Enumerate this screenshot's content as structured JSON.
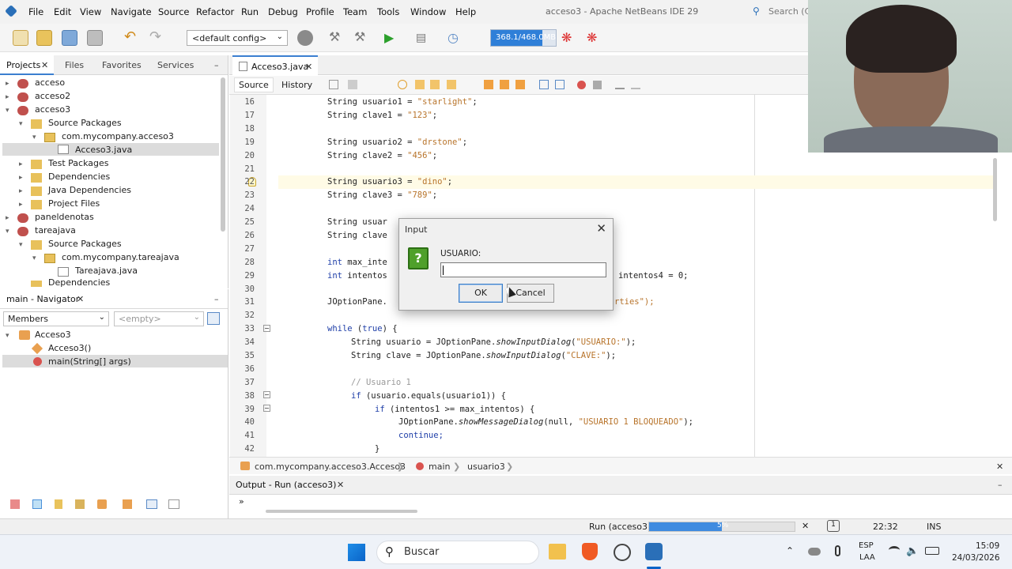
{
  "window": {
    "title": "acceso3 - Apache NetBeans IDE 29",
    "search_placeholder": "Search (Ct"
  },
  "menu": [
    "File",
    "Edit",
    "View",
    "Navigate",
    "Source",
    "Refactor",
    "Run",
    "Debug",
    "Profile",
    "Team",
    "Tools",
    "Window",
    "Help"
  ],
  "toolbar": {
    "config": "<default config>",
    "memory": "368.1/468.0MB",
    "memory_used_fraction": 0.79
  },
  "projects_panel": {
    "tabs": [
      "Projects",
      "Files",
      "Favorites",
      "Services"
    ],
    "tree": [
      "acceso",
      "acceso2",
      "acceso3",
      "Source Packages",
      "com.mycompany.acceso3",
      "Acceso3.java",
      "Test Packages",
      "Dependencies",
      "Java Dependencies",
      "Project Files",
      "paneldenotas",
      "tareajava",
      "Source Packages",
      "com.mycompany.tareajava",
      "Tareajava.java",
      "Dependencies"
    ]
  },
  "navigator": {
    "title": "main - Navigator",
    "members": "Members",
    "empty": "<empty>",
    "tree": [
      "Acceso3",
      "Acceso3()",
      "main(String[] args)"
    ]
  },
  "editor": {
    "tab": "Acceso3.java",
    "views": [
      "Source",
      "History"
    ],
    "line_numbers": [
      "16",
      "17",
      "18",
      "19",
      "20",
      "21",
      "22",
      "23",
      "24",
      "25",
      "26",
      "27",
      "28",
      "29",
      "30",
      "31",
      "32",
      "33",
      "34",
      "35",
      "36",
      "37",
      "38",
      "39",
      "40",
      "41",
      "42"
    ],
    "code": {
      "l16a": "String usuario1 = ",
      "l16b": "\"starlight\"",
      "l16c": ";",
      "l17a": "String clave1 = ",
      "l17b": "\"123\"",
      "l17c": ";",
      "l19a": "String usuario2 = ",
      "l19b": "\"drstone\"",
      "l19c": ";",
      "l20a": "String clave2 = ",
      "l20b": "\"456\"",
      "l20c": ";",
      "l22a": "String usuario3 = ",
      "l22b": "\"dino\"",
      "l22c": ";",
      "l23a": "String clave3 = ",
      "l23b": "\"789\"",
      "l23c": ";",
      "l25": "String usuar",
      "l26": "String clave",
      "l28a": "int",
      "l28b": " max_inte",
      "l29a": "int",
      "l29b": " intentos",
      "l29c": "intentos4 = 0;",
      "l31": "JOptionPane.",
      "l31b": "rties\");",
      "l33a": "while",
      "l33b": " (",
      "l33c": "true",
      "l33d": ") {",
      "l34a": "String usuario = JOptionPane.",
      "l34b": "showInputDialog",
      "l34c": "(",
      "l34d": "\"USUARIO:\"",
      "l34e": ");",
      "l35a": "String clave = JOptionPane.",
      "l35b": "showInputDialog",
      "l35c": "(",
      "l35d": "\"CLAVE:\"",
      "l35e": ");",
      "l37": "// Usuario 1",
      "l38a": "if",
      "l38b": " (usuario.equals(usuario1)) {",
      "l39a": "if",
      "l39b": " (intentos1 >= max_intentos) {",
      "l40a": "JOptionPane.",
      "l40b": "showMessageDialog",
      "l40c": "(null, ",
      "l40d": "\"USUARIO 1 BLOQUEADO\"",
      "l40e": ");",
      "l41": "continue;",
      "l42": "}"
    }
  },
  "breadcrumb": [
    "com.mycompany.acceso3.Acceso3",
    "main",
    "usuario3"
  ],
  "output": {
    "tab": "Output - Run (acceso3)",
    "arrow": "»"
  },
  "status": {
    "run": "Run (acceso3)",
    "progress": "5%",
    "progress_fraction": 0.5,
    "notifications": "1",
    "position": "22:32",
    "mode": "INS"
  },
  "dialog": {
    "title": "Input",
    "label": "USUARIO:",
    "ok": "OK",
    "cancel": "Cancel",
    "icon": "?"
  },
  "taskbar": {
    "search": "Buscar",
    "lang1": "ESP",
    "lang2": "LAA",
    "time": "15:09",
    "date": "24/03/2026"
  }
}
